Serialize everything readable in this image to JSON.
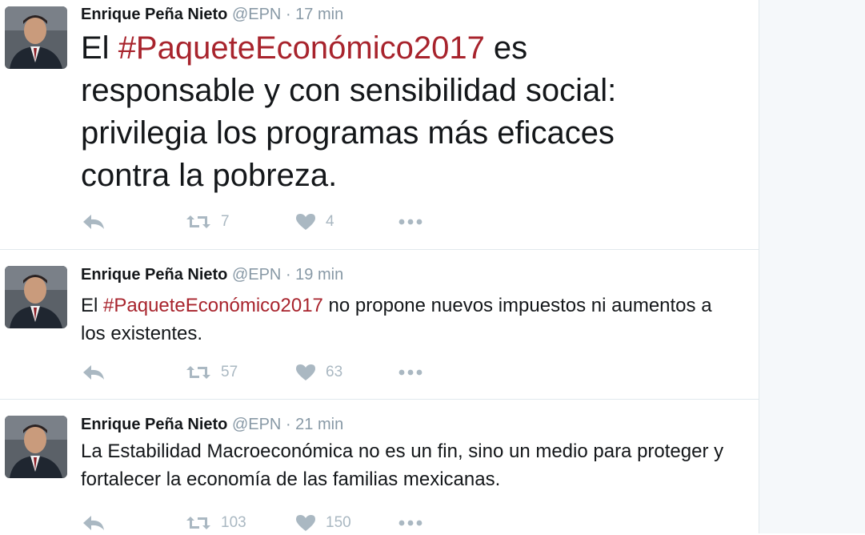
{
  "tweets": [
    {
      "name": "Enrique Peña Nieto",
      "handle": "@EPN",
      "separator": "·",
      "time": "17 min",
      "text_before": "El ",
      "hashtag": "#PaqueteEconómico2017",
      "text_after": " es responsable y con sensibilidad social: privilegia los programas más eficaces contra la pobreza.",
      "retweets": "7",
      "likes": "4"
    },
    {
      "name": "Enrique Peña Nieto",
      "handle": "@EPN",
      "separator": "·",
      "time": "19 min",
      "text_before": "El ",
      "hashtag": "#PaqueteEconómico2017",
      "text_after": " no propone nuevos impuestos ni aumentos a los existentes.",
      "retweets": "57",
      "likes": "63"
    },
    {
      "name": "Enrique Peña Nieto",
      "handle": "@EPN",
      "separator": "·",
      "time": "21 min",
      "text_before": "La Estabilidad Macroeconómica no es un fin, sino un medio para proteger y fortalecer la economía de las familias mexicanas.",
      "hashtag": "",
      "text_after": "",
      "retweets": "103",
      "likes": "150"
    }
  ],
  "icons": {
    "reply": "reply-icon",
    "retweet": "retweet-icon",
    "like": "heart-icon",
    "more": "more-icon"
  },
  "colors": {
    "hashtag": "#a8242d",
    "meta": "#8899a6",
    "action": "#aab8c2"
  }
}
